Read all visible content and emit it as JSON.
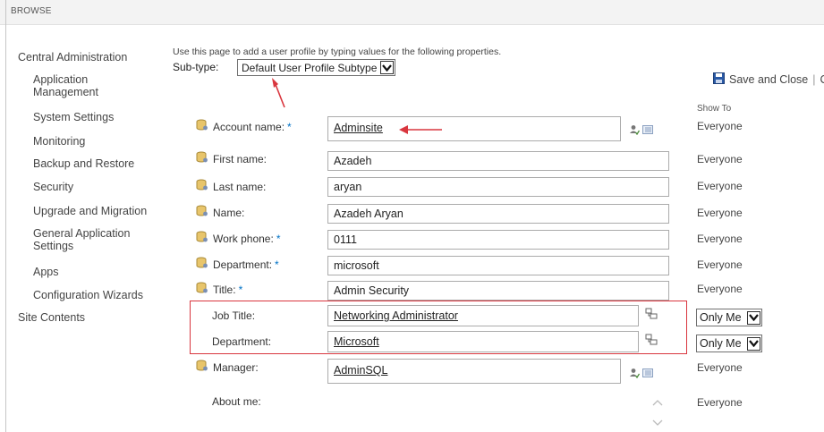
{
  "ribbon": {
    "tab_label": "BROWSE"
  },
  "quick_launch": {
    "root": "Central Administration",
    "items": [
      {
        "label": "Application\nManagement",
        "line1": "Application",
        "line2": "Management"
      },
      {
        "label": "System Settings"
      },
      {
        "label": "Monitoring"
      },
      {
        "label": "Backup and Restore"
      },
      {
        "label": "Security"
      },
      {
        "label": "Upgrade and Migration"
      },
      {
        "label": "General Application Settings",
        "line1": "General Application",
        "line2": "Settings"
      },
      {
        "label": "Apps"
      },
      {
        "label": "Configuration Wizards"
      }
    ],
    "site_contents": "Site Contents"
  },
  "form": {
    "description": "Use this page to add a user profile by typing values for the following properties.",
    "subtype_label": "Sub-type:",
    "subtype_value": "Default User Profile Subtype",
    "save_close_label": "Save and Close",
    "cancel_label_partial": "Ca",
    "show_to_header": "Show To",
    "fields": [
      {
        "label": "Account name:",
        "required": "*",
        "value": "Adminsite",
        "show_to": "Everyone"
      },
      {
        "label": "First name:",
        "value": "Azadeh",
        "show_to": "Everyone"
      },
      {
        "label": "Last name:",
        "value": "aryan",
        "show_to": "Everyone"
      },
      {
        "label": "Name:",
        "value": "Azadeh Aryan",
        "show_to": "Everyone"
      },
      {
        "label": "Work phone:",
        "required": "*",
        "value": "0111",
        "show_to": "Everyone"
      },
      {
        "label": "Department:",
        "required": "*",
        "value": "microsoft",
        "show_to": "Everyone"
      },
      {
        "label": "Title:",
        "required": "*",
        "value": "Admin Security",
        "show_to": "Everyone"
      },
      {
        "label": "Job Title:",
        "value": "Networking Administrator",
        "show_to": "Only Me"
      },
      {
        "label": "Department:",
        "value": "Microsoft",
        "show_to": "Only Me"
      },
      {
        "label": "Manager:",
        "value": "AdminSQL",
        "show_to": "Everyone"
      },
      {
        "label": "About me:",
        "value": "",
        "show_to": "Everyone"
      }
    ]
  },
  "colors": {
    "accent_blue": "#0072c6",
    "annotation_red": "#d9363e",
    "ribbon_bg": "#f3f3f3"
  },
  "icons": [
    "database-user-icon",
    "check-names-icon",
    "browse-address-book-icon",
    "policy-icon",
    "save-disk-icon",
    "chevron-down-icon",
    "scroll-up-icon",
    "scroll-down-icon"
  ]
}
